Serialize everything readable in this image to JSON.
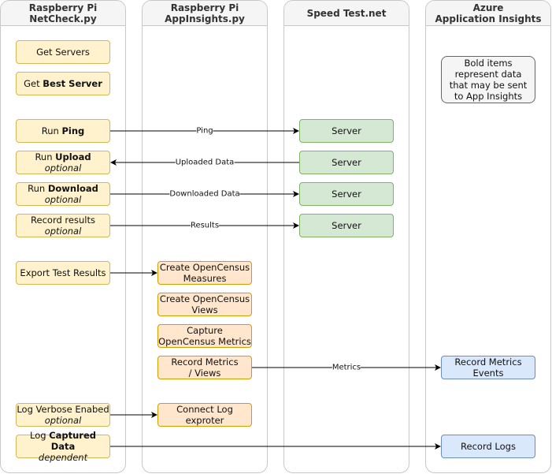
{
  "lanes": [
    {
      "title_line1": "Raspberry Pi",
      "title_line2": "NetCheck.py"
    },
    {
      "title_line1": "Raspberry Pi",
      "title_line2": "AppInsights.py"
    },
    {
      "title_line1": "Speed Test.net",
      "title_line2": ""
    },
    {
      "title_line1": "Azure",
      "title_line2": "Application Insights"
    }
  ],
  "netcheck": {
    "get_servers": "Get Servers",
    "get_best_prefix": "Get ",
    "get_best_bold": "Best Server",
    "run_ping_prefix": "Run ",
    "run_ping_bold": "Ping",
    "run_upload_prefix": "Run ",
    "run_upload_bold": "Upload",
    "run_upload_note": "optional",
    "run_download_prefix": "Run ",
    "run_download_bold": "Download",
    "run_download_note": "optional",
    "record_results": "Record results",
    "record_results_note": "optional",
    "export": "Export Test Results",
    "log_verbose": "Log Verbose Enabed",
    "log_verbose_note": "optional",
    "log_captured_prefix": "Log ",
    "log_captured_bold": "Captured Data",
    "log_captured_note": "dependent"
  },
  "appinsights": {
    "create_measures": "Create OpenCensus Measures",
    "create_views": "Create OpenCensus Views",
    "capture_metrics": "Capture OpenCensus Metrics",
    "record_metrics": "Record Metrics / Views",
    "connect_log": "Connect Log exproter"
  },
  "speedtest": {
    "servers": [
      "Server",
      "Server",
      "Server",
      "Server"
    ]
  },
  "azure": {
    "note": "Bold items represent data that may be sent to App Insights",
    "record_metrics_events": "Record Metrics Events",
    "record_logs": "Record Logs"
  },
  "edges": {
    "ping": "Ping",
    "uploaded": "Uploaded Data",
    "downloaded": "Downloaded Data",
    "results": "Results",
    "metrics": "Metrics"
  },
  "colors": {
    "yellow_fill": "#fff2cc",
    "orange_fill": "#ffe6cc",
    "green_fill": "#d5e8d4",
    "blue_fill": "#dae8fc"
  }
}
